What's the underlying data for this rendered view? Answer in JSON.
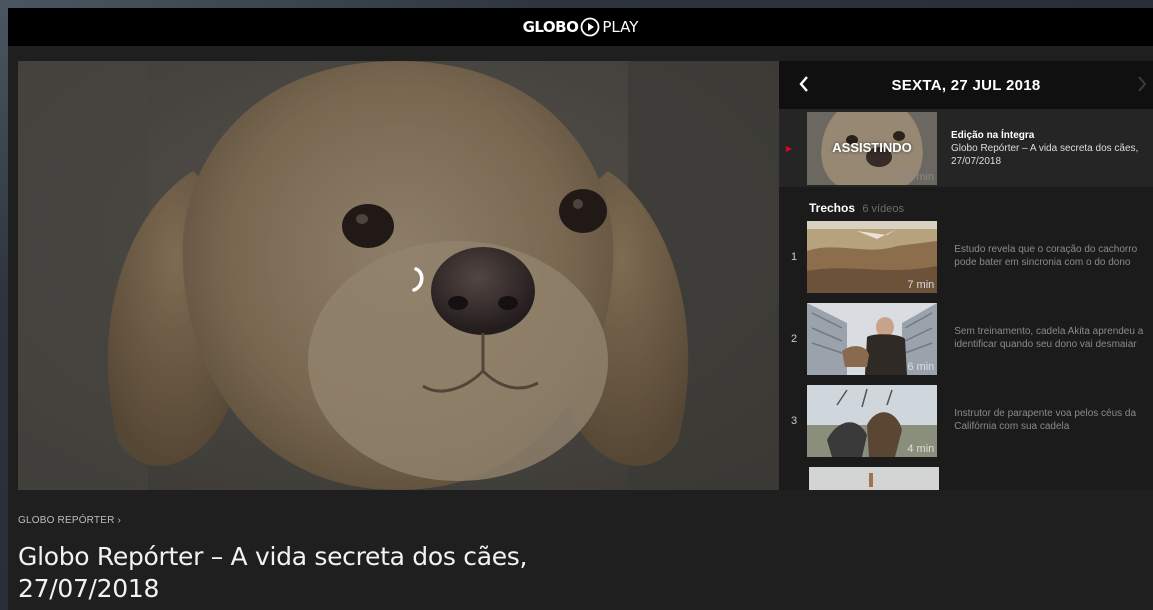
{
  "app": {
    "logo_text_bold": "GLOBO",
    "logo_text_light": "PLAY"
  },
  "player": {
    "state": "loading",
    "spinner_icon": "loading-spinner-icon"
  },
  "sidebar": {
    "date": "SEXTA, 27 JUL 2018",
    "prev_icon": "chevron-left-icon",
    "next_icon": "chevron-right-icon",
    "now_playing": {
      "badge": "ASSISTINDO",
      "duration": "43 min",
      "title": "Edição na Íntegra",
      "description_line1": "Globo Repórter – A vida secreta dos cães,",
      "description_line2": "27/07/2018"
    },
    "section": {
      "title": "Trechos",
      "count": "6 vídeos"
    },
    "clips": [
      {
        "number": "1",
        "duration": "7 min",
        "line1": "Estudo revela que o coração do cachorro",
        "line2": "pode bater em sincronia com o do dono"
      },
      {
        "number": "2",
        "duration": "6 min",
        "line1": "Sem treinamento, cadela Akita aprendeu a",
        "line2": "identificar quando seu dono vai desmaiar"
      },
      {
        "number": "3",
        "duration": "4 min",
        "line1": "Instrutor de parapente voa pelos céus da",
        "line2": "Califórnia com sua cadela"
      }
    ]
  },
  "meta": {
    "breadcrumb": "GLOBO REPÓRTER ›",
    "title_line1": "Globo Repórter – A vida secreta dos cães,",
    "title_line2": "27/07/2018"
  },
  "colors": {
    "accent_red": "#e4002b",
    "topbar": "#000000",
    "panel": "#1f1f1f"
  }
}
